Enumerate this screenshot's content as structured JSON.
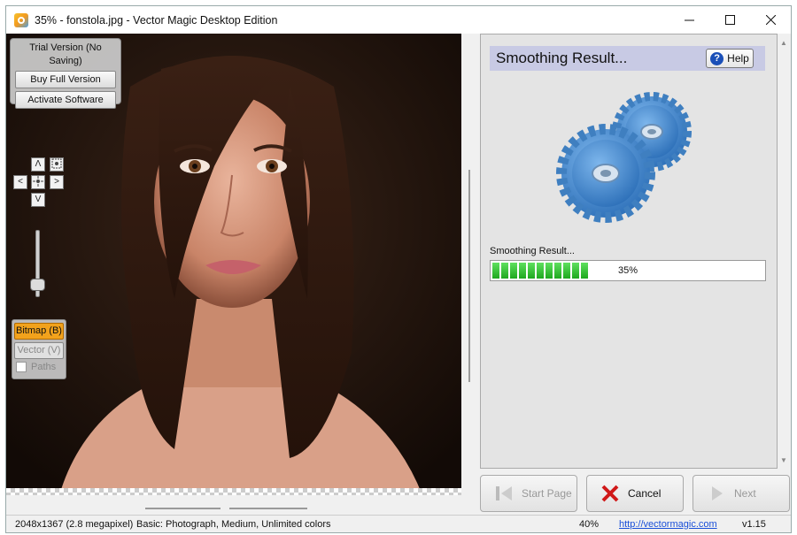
{
  "window": {
    "title": "35% - fonstola.jpg - Vector Magic Desktop Edition",
    "controls": [
      "minimize-icon",
      "maximize-icon",
      "close-icon"
    ]
  },
  "trial": {
    "label": "Trial Version (No Saving)",
    "buy_label": "Buy Full Version",
    "activate_label": "Activate Software"
  },
  "nav": {
    "up": "Λ",
    "down": "V",
    "left": "<",
    "right": ">"
  },
  "view_modes": {
    "bitmap_label": "Bitmap (B)",
    "vector_label": "Vector (V)",
    "paths_label": "Paths",
    "active": "bitmap",
    "paths_checked": false
  },
  "process": {
    "header_title": "Smoothing Result...",
    "help_label": "Help",
    "progress_label": "Smoothing Result...",
    "progress_text": "35%",
    "progress_value": 0.35
  },
  "buttons": {
    "start_page": "Start Page",
    "cancel": "Cancel",
    "next": "Next"
  },
  "status": {
    "dimensions": "2048x1367 (2.8 megapixel)",
    "settings": "Basic: Photograph, Medium, Unlimited colors",
    "zoom": "40%",
    "link": "http://vectormagic.com",
    "version": "v1.15"
  }
}
